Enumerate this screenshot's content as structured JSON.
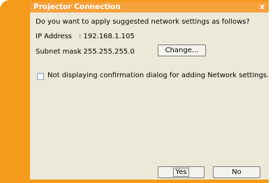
{
  "window": {
    "title": "Projector Connection",
    "close_icon": "close-icon",
    "close_glyph": "x"
  },
  "dialog": {
    "prompt": "Do you want to apply suggested network settings as follows?",
    "ip_label": "IP Address",
    "ip_value": ": 192.168.1.105",
    "subnet_label": "Subnet mask",
    "subnet_value": ": 255.255.255.0",
    "change_button": "Change...",
    "checkbox_label": "Not displaying confirmation dialog for adding Network settings.",
    "checkbox_checked": false,
    "yes_button": "Yes",
    "no_button": "No"
  },
  "colors": {
    "frame_accent": "#f59a1a",
    "dialog_background": "#ece9d8"
  }
}
